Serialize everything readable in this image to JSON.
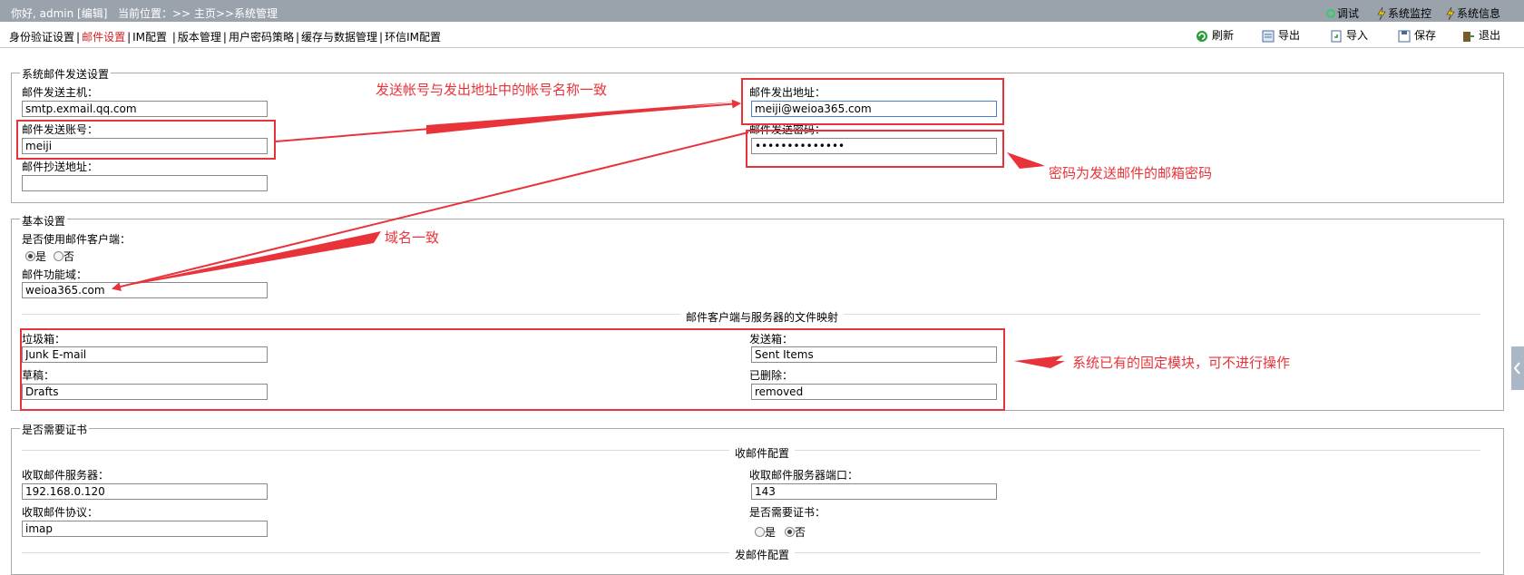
{
  "topbar": {
    "greeting": "你好, admin [编辑]",
    "location": "当前位置：>> 主页>>系统管理",
    "links": [
      "调试",
      "系统监控",
      "系统信息"
    ]
  },
  "menu": {
    "items": [
      "身份验证设置",
      "邮件设置",
      "IM配置",
      "版本管理",
      "用户密码策略",
      "缓存与数据管理",
      "环信IM配置"
    ],
    "active": "邮件设置"
  },
  "toolbar": {
    "refresh": "刷新",
    "export": "导出",
    "import": "导入",
    "save": "保存",
    "logout": "退出"
  },
  "mail_send": {
    "legend": "系统邮件发送设置",
    "host_label": "邮件发送主机：",
    "host_value": "smtp.exmail.qq.com",
    "account_label": "邮件发送账号：",
    "account_value": "meiji",
    "cc_label": "邮件抄送地址：",
    "cc_value": "",
    "from_label": "邮件发出地址：",
    "from_value": "meiji@weioa365.com",
    "password_label": "邮件发送密码：",
    "password_value": "••••••••••••••"
  },
  "basic": {
    "legend": "基本设置",
    "use_client_label": "是否使用邮件客户端：",
    "yes": "是",
    "no": "否",
    "domain_label": "邮件功能域：",
    "domain_value": "weioa365.com",
    "mapping_title": "邮件客户端与服务器的文件映射",
    "junk_label": "垃圾箱：",
    "junk_value": "Junk E-mail",
    "sent_label": "发送箱：",
    "sent_value": "Sent Items",
    "drafts_label": "草稿：",
    "drafts_value": "Drafts",
    "deleted_label": "已删除：",
    "deleted_value": "removed"
  },
  "cert": {
    "legend": "是否需要证书",
    "receive_title": "收邮件配置",
    "recv_server_label": "收取邮件服务器：",
    "recv_server_value": "192.168.0.120",
    "recv_port_label": "收取邮件服务器端口：",
    "recv_port_value": "143",
    "protocol_label": "收取邮件协议：",
    "protocol_value": "imap",
    "need_cert_label": "是否需要证书：",
    "yes": "是",
    "no": "否",
    "send_title": "发邮件配置"
  },
  "annotations": {
    "account_match": "发送帐号与发出地址中的帐号名称一致",
    "password_note": "密码为发送邮件的邮箱密码",
    "domain_match": "域名一致",
    "fixed_modules": "系统已有的固定模块，可不进行操作"
  },
  "colors": {
    "annotation_red": "#e8333a",
    "topbar_bg": "#9aa3ab",
    "active_menu": "#d21f1f"
  }
}
